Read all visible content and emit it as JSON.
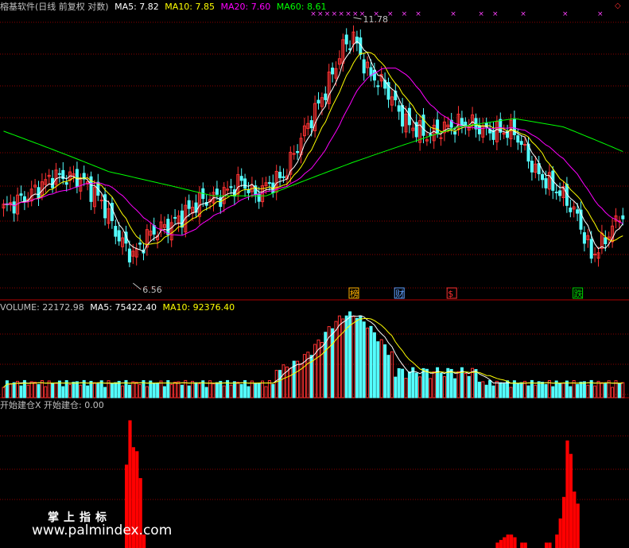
{
  "header": {
    "title": "榕基软件(日线 前复权 对数)",
    "ma5": "MA5: 7.82",
    "ma10": "MA10: 7.85",
    "ma20": "MA20: 7.60",
    "ma60": "MA60: 8.61"
  },
  "volume_header": {
    "volume": "VOLUME: 22172.98",
    "ma5": "MA5: 75422.40",
    "ma10": "MA10: 92376.40"
  },
  "indicator_header": {
    "label": "开始建仓X 开始建仓: 0.00"
  },
  "watermark": {
    "line1": "掌上指标",
    "line2": "www.palmindex.com"
  },
  "colors": {
    "up": "#ff3232",
    "down": "#54ffff",
    "ma5": "#ffffff",
    "ma10": "#ffff00",
    "ma20": "#ff00ff",
    "ma60": "#00ff00",
    "grid": "#8b0000",
    "signal_bar": "#ff0000"
  },
  "chart_data": [
    {
      "type": "candlestick",
      "title": "榕基软件(日线 前复权 对数)",
      "scale": "log",
      "ylim": [
        6.2,
        12.4
      ],
      "annotations": [
        {
          "label": "11.78",
          "kind": "max",
          "index": 100
        },
        {
          "label": "6.56",
          "kind": "min",
          "index": 37
        }
      ],
      "event_markers": [
        {
          "label": "榜",
          "index": 100,
          "color": "#ffb000"
        },
        {
          "label": "财",
          "index": 113,
          "color": "#60a0ff"
        },
        {
          "label": "$",
          "index": 128,
          "color": "#ff3030"
        },
        {
          "label": "跌",
          "index": 164,
          "color": "#00d000"
        }
      ],
      "ma_lines": [
        "MA5",
        "MA10",
        "MA20",
        "MA60"
      ],
      "legend": "top"
    },
    {
      "type": "bar",
      "title": "VOLUME",
      "series_lines": [
        "MA5",
        "MA10"
      ],
      "values": {
        "VOLUME": 22172.98,
        "MA5": 75422.4,
        "MA10": 92376.4
      }
    },
    {
      "type": "bar",
      "title": "开始建仓",
      "value": 0.0,
      "clusters": [
        {
          "start": 34,
          "values": [
            0.0,
            0.62,
            0.95,
            0.75,
            0.72,
            0.52,
            0.1,
            0.0
          ]
        },
        {
          "start": 141,
          "values": [
            0.04,
            0.06,
            0.08,
            0.1,
            0.1,
            0.08,
            0.0,
            0.04,
            0.04,
            0.0,
            0.0,
            0.0
          ]
        },
        {
          "start": 155,
          "values": [
            0.04,
            0.04,
            0.0,
            0.1,
            0.22,
            0.38,
            0.8,
            0.7,
            0.42,
            0.33
          ]
        }
      ]
    }
  ]
}
